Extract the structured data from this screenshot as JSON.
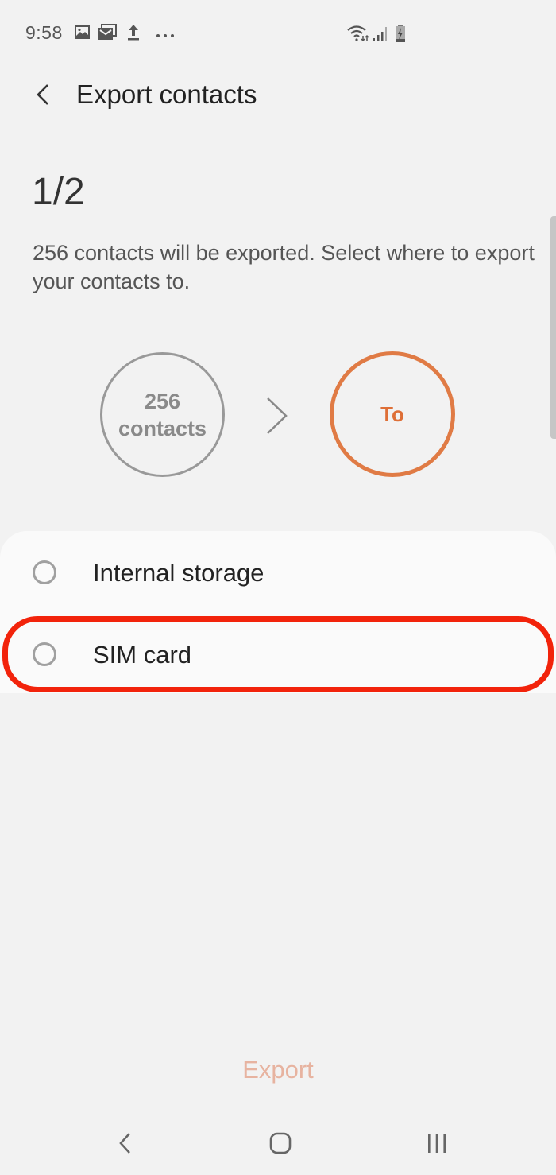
{
  "status_bar": {
    "time": "9:58",
    "left_icons": [
      "gallery-notification-icon",
      "email-notification-icon",
      "upload-notification-icon",
      "more-notifications-icon"
    ],
    "right_icons": [
      "wifi-icon",
      "signal-icon",
      "battery-charging-icon"
    ]
  },
  "app_bar": {
    "back_icon": "chevron-left-icon",
    "title": "Export contacts"
  },
  "step": "1/2",
  "description": "256 contacts will be exported. Select where to export your contacts to.",
  "flow": {
    "source_count": "256",
    "source_label": "contacts",
    "arrow_icon": "chevron-right-icon",
    "destination_label": "To"
  },
  "options": [
    {
      "label": "Internal storage",
      "selected": false
    },
    {
      "label": "SIM card",
      "selected": false,
      "highlighted": true
    }
  ],
  "colors": {
    "accent": "#e07b45",
    "highlight": "#f2230b",
    "export_disabled": "#e7b3a0"
  },
  "footer": {
    "export_label": "Export",
    "export_enabled": false
  },
  "nav_bar": {
    "back_icon": "nav-back-icon",
    "home_icon": "nav-home-icon",
    "recents_icon": "nav-recents-icon"
  }
}
